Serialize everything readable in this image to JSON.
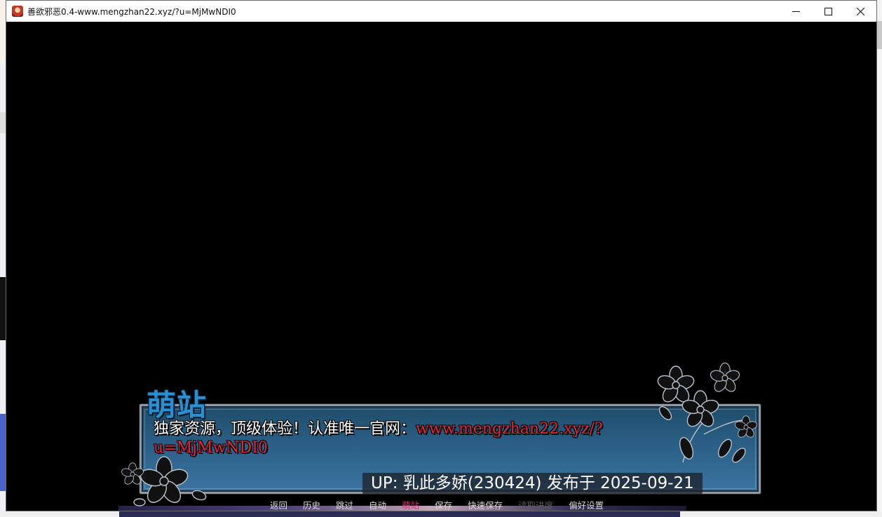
{
  "window": {
    "title": "善欲邪恶0.4-www.mengzhan22.xyz/?u=MjMwNDI0",
    "app_icon": "game-app-icon"
  },
  "controls": {
    "minimize_icon": "minimize-icon",
    "maximize_icon": "maximize-icon",
    "close_icon": "close-icon"
  },
  "dialogue": {
    "speaker": "萌站",
    "text": "独家资源，顶级体验！认准唯一官网：",
    "url": "www.mengzhan22.xyz/?u=MjMwNDI0",
    "upload_info": "UP: 乳此多娇(230424) 发布于 2025-09-21"
  },
  "quick_menu": [
    {
      "label": "返回",
      "state": "normal"
    },
    {
      "label": "历史",
      "state": "normal"
    },
    {
      "label": "跳过",
      "state": "normal"
    },
    {
      "label": "自动",
      "state": "normal"
    },
    {
      "label": "萌站",
      "state": "active"
    },
    {
      "label": "保存",
      "state": "normal"
    },
    {
      "label": "快速保存",
      "state": "normal"
    },
    {
      "label": "读取进度",
      "state": "disabled"
    },
    {
      "label": "偏好设置",
      "state": "normal"
    }
  ],
  "colors": {
    "speaker": "#2a8fd0",
    "url": "#e8283a",
    "menu_active": "#e0357c",
    "menu_disabled": "#5a5a5a",
    "textbox_blue": "#2b5f86"
  }
}
